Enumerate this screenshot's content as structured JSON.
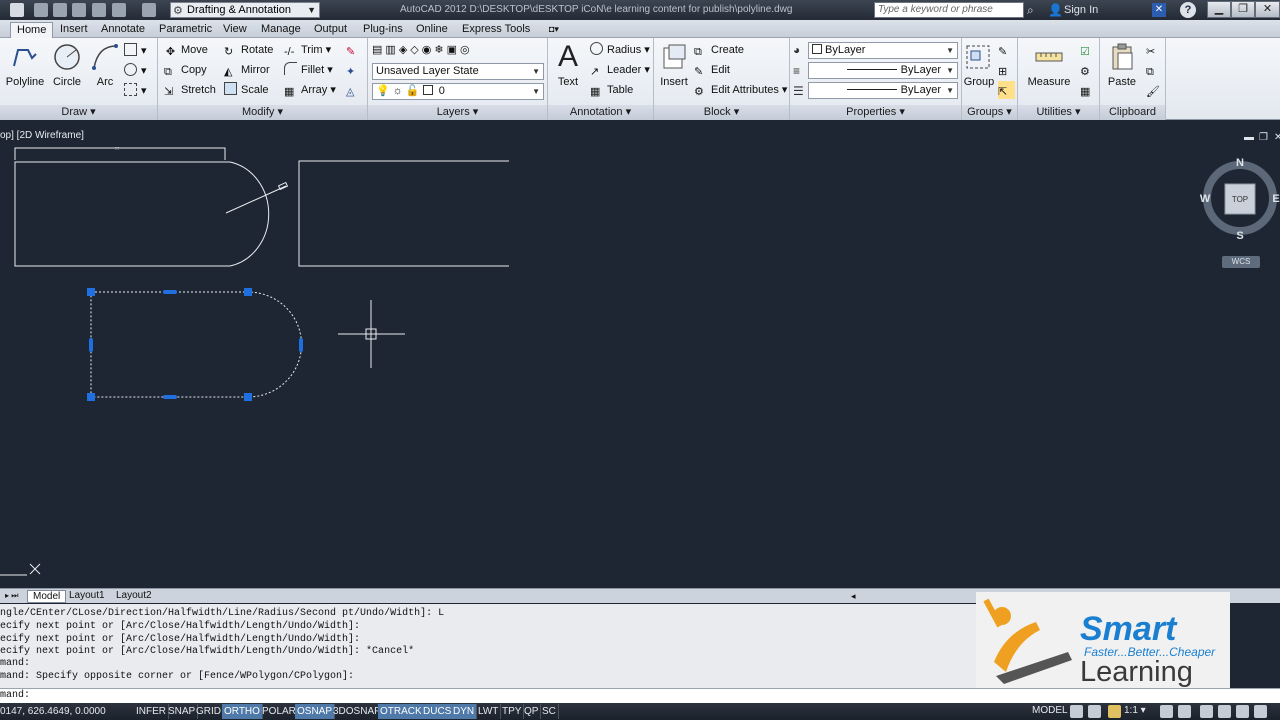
{
  "title_bar": {
    "workspace": "Drafting & Annotation",
    "title": "AutoCAD 2012    D:\\DESKTOP\\dESKTOP iCoN\\e learning content for publish\\polyline.dwg",
    "search_placeholder": "Type a keyword or phrase",
    "signin": "Sign In"
  },
  "tabs": [
    "Home",
    "Insert",
    "Annotate",
    "Parametric",
    "View",
    "Manage",
    "Output",
    "Plug-ins",
    "Online",
    "Express Tools"
  ],
  "ribbon": {
    "draw": {
      "label": "Draw",
      "tools": [
        "Polyline",
        "Circle",
        "Arc"
      ]
    },
    "modify": {
      "label": "Modify",
      "tools": [
        "Move",
        "Rotate",
        "Trim",
        "Copy",
        "Mirror",
        "Fillet",
        "Stretch",
        "Scale",
        "Array"
      ]
    },
    "layers": {
      "label": "Layers",
      "layer_state": "Unsaved Layer State",
      "current_layer": "0"
    },
    "annotation": {
      "label": "Annotation",
      "text": "Text",
      "tools": [
        "Radius",
        "Leader",
        "Table"
      ]
    },
    "block": {
      "label": "Block",
      "insert": "Insert",
      "tools": [
        "Create",
        "Edit",
        "Edit Attributes"
      ]
    },
    "properties": {
      "label": "Properties",
      "color": "ByLayer",
      "linetype": "ByLayer",
      "lineweight": "ByLayer"
    },
    "groups": {
      "label": "Groups",
      "group": "Group"
    },
    "utilities": {
      "label": "Utilities",
      "measure": "Measure"
    },
    "clipboard": {
      "label": "Clipboard",
      "paste": "Paste"
    }
  },
  "viewport": {
    "label": "op] [2D Wireframe]",
    "compass": {
      "n": "N",
      "s": "S",
      "e": "E",
      "w": "W",
      "top": "TOP"
    },
    "wcs": "WCS"
  },
  "layout_tabs": [
    "Model",
    "Layout1",
    "Layout2"
  ],
  "command_history": [
    "ngle/CEnter/CLose/Direction/Halfwidth/Line/Radius/Second pt/Undo/Width]: L",
    "ecify next point or [Arc/Close/Halfwidth/Length/Undo/Width]:",
    "ecify next point or [Arc/Close/Halfwidth/Length/Undo/Width]:",
    "ecify next point or [Arc/Close/Halfwidth/Length/Undo/Width]: *Cancel*",
    "mand:",
    "mand: Specify opposite corner or [Fence/WPolygon/CPolygon]:"
  ],
  "command_prompt": "mand:",
  "logo": {
    "smart": "Smart",
    "tagline": "Faster...Better...Cheaper",
    "learning": "Learning"
  },
  "status": {
    "coords": "0147, 626.4649, 0.0000",
    "toggles": [
      {
        "label": "INFER",
        "on": false
      },
      {
        "label": "SNAP",
        "on": false
      },
      {
        "label": "GRID",
        "on": false
      },
      {
        "label": "ORTHO",
        "on": true
      },
      {
        "label": "POLAR",
        "on": false
      },
      {
        "label": "OSNAP",
        "on": true
      },
      {
        "label": "3DOSNAP",
        "on": false
      },
      {
        "label": "OTRACK",
        "on": true
      },
      {
        "label": "DUCS",
        "on": true
      },
      {
        "label": "DYN",
        "on": true
      },
      {
        "label": "LWT",
        "on": false
      },
      {
        "label": "TPY",
        "on": false
      },
      {
        "label": "QP",
        "on": false
      },
      {
        "label": "SC",
        "on": false
      }
    ],
    "model": "MODEL",
    "scale": "1:1"
  }
}
